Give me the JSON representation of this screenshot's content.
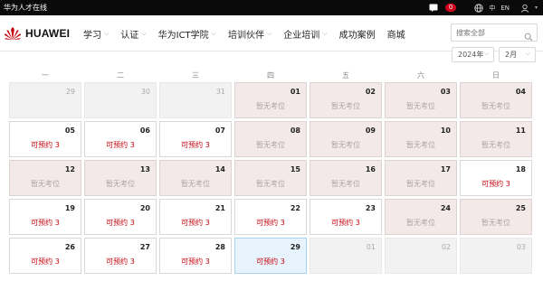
{
  "topbar": {
    "site_name": "华为人才在线",
    "message_count": "0",
    "lang_zh": "中",
    "lang_en": "EN"
  },
  "brand": {
    "name": "HUAWEI",
    "color": "#c7000b"
  },
  "nav": {
    "items": [
      {
        "label": "学习",
        "dropdown": true
      },
      {
        "label": "认证",
        "dropdown": true
      },
      {
        "label": "华为ICT学院",
        "dropdown": true
      },
      {
        "label": "培训伙伴",
        "dropdown": true
      },
      {
        "label": "企业培训",
        "dropdown": true
      },
      {
        "label": "成功案例",
        "dropdown": false
      },
      {
        "label": "商城",
        "dropdown": false
      }
    ],
    "search_placeholder": "搜索全部"
  },
  "calendar": {
    "year": "2024年",
    "month": "2月",
    "weekdays": [
      "一",
      "二",
      "三",
      "四",
      "五",
      "六",
      "日"
    ],
    "colors": {
      "available": "#c7000b",
      "full_bg": "#f3e9e9",
      "today_bg": "#e7f4fd"
    },
    "days": [
      {
        "day": "29",
        "state": "outside",
        "status": ""
      },
      {
        "day": "30",
        "state": "outside",
        "status": ""
      },
      {
        "day": "31",
        "state": "outside",
        "status": ""
      },
      {
        "day": "01",
        "state": "full",
        "status": "暂无考位"
      },
      {
        "day": "02",
        "state": "full",
        "status": "暂无考位"
      },
      {
        "day": "03",
        "state": "full",
        "status": "暂无考位"
      },
      {
        "day": "04",
        "state": "full",
        "status": "暂无考位"
      },
      {
        "day": "05",
        "state": "avail",
        "status": "可预约 3"
      },
      {
        "day": "06",
        "state": "avail",
        "status": "可预约 3"
      },
      {
        "day": "07",
        "state": "avail",
        "status": "可预约 3"
      },
      {
        "day": "08",
        "state": "full",
        "status": "暂无考位"
      },
      {
        "day": "09",
        "state": "full",
        "status": "暂无考位"
      },
      {
        "day": "10",
        "state": "full",
        "status": "暂无考位"
      },
      {
        "day": "11",
        "state": "full",
        "status": "暂无考位"
      },
      {
        "day": "12",
        "state": "full",
        "status": "暂无考位"
      },
      {
        "day": "13",
        "state": "full",
        "status": "暂无考位"
      },
      {
        "day": "14",
        "state": "full",
        "status": "暂无考位"
      },
      {
        "day": "15",
        "state": "full",
        "status": "暂无考位"
      },
      {
        "day": "16",
        "state": "full",
        "status": "暂无考位"
      },
      {
        "day": "17",
        "state": "full",
        "status": "暂无考位"
      },
      {
        "day": "18",
        "state": "avail",
        "status": "可预约 3"
      },
      {
        "day": "19",
        "state": "avail",
        "status": "可预约 3"
      },
      {
        "day": "20",
        "state": "avail",
        "status": "可预约 3"
      },
      {
        "day": "21",
        "state": "avail",
        "status": "可预约 3"
      },
      {
        "day": "22",
        "state": "avail",
        "status": "可预约 3"
      },
      {
        "day": "23",
        "state": "avail",
        "status": "可预约 3"
      },
      {
        "day": "24",
        "state": "full",
        "status": "暂无考位"
      },
      {
        "day": "25",
        "state": "full",
        "status": "暂无考位"
      },
      {
        "day": "26",
        "state": "avail",
        "status": "可预约 3"
      },
      {
        "day": "27",
        "state": "avail",
        "status": "可预约 3"
      },
      {
        "day": "28",
        "state": "avail",
        "status": "可预约 3"
      },
      {
        "day": "29",
        "state": "today",
        "status": "可预约 3"
      },
      {
        "day": "01",
        "state": "outside",
        "status": ""
      },
      {
        "day": "02",
        "state": "outside",
        "status": ""
      },
      {
        "day": "03",
        "state": "outside",
        "status": ""
      }
    ]
  }
}
